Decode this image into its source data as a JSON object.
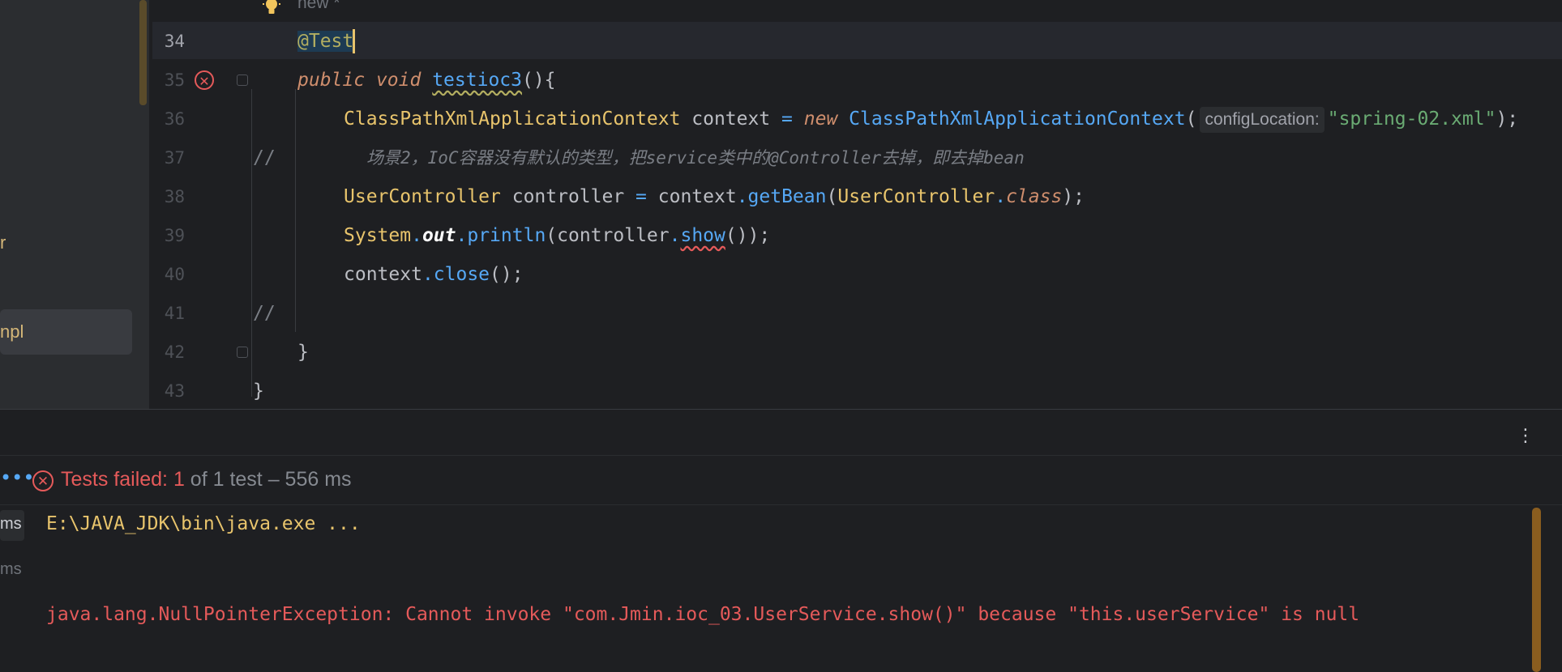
{
  "sidebar": {
    "items": [
      {
        "label": "r"
      },
      {
        "label": "npl"
      }
    ]
  },
  "editor": {
    "inlay_new": "new *",
    "lines": [
      {
        "num": "34"
      },
      {
        "num": "35"
      },
      {
        "num": "36"
      },
      {
        "num": "37"
      },
      {
        "num": "38"
      },
      {
        "num": "39"
      },
      {
        "num": "40"
      },
      {
        "num": "41"
      },
      {
        "num": "42"
      },
      {
        "num": "43"
      }
    ],
    "code": {
      "l34_annot": "@Test",
      "l35_kw1": "public",
      "l35_kw2": "void",
      "l35_name": "testioc3",
      "l35_rest": "(){",
      "l36_type": "ClassPathXmlApplicationContext",
      "l36_var": " context ",
      "l36_eq": "=",
      "l36_new": " new ",
      "l36_ctor": "ClassPathXmlApplicationContext",
      "l36_paren": "(",
      "l36_hint": "configLocation:",
      "l36_str": "\"spring-02.xml\"",
      "l36_end": ");",
      "l37_slash": "//",
      "l37_comment": "场景2，IoC容器没有默认的类型，把service类中的@Controller去掉，即去掉bean",
      "l38_type": "UserController",
      "l38_var": " controller ",
      "l38_eq": "=",
      "l38_ctx": " context",
      "l38_dot": ".",
      "l38_fn": "getBean",
      "l38_p1": "(",
      "l38_cls": "UserController",
      "l38_dot2": ".",
      "l38_kw": "class",
      "l38_end": ");",
      "l39_sys": "System",
      "l39_dot": ".",
      "l39_out": "out",
      "l39_dot2": ".",
      "l39_fn": "println",
      "l39_p1": "(controller",
      "l39_dot3": ".",
      "l39_show": "show",
      "l39_end": "());",
      "l40_ctx": "context",
      "l40_dot": ".",
      "l40_fn": "close",
      "l40_end": "();",
      "l41_slash": "//",
      "l42_brace": "}",
      "l43_brace": "}"
    }
  },
  "toolwindow": {
    "menu_icon": "kebab-menu-icon",
    "status_fail": "Tests failed: 1",
    "status_rest": " of 1 test – 556 ms",
    "left_times": [
      "ms",
      "ms"
    ],
    "console_cmd": "E:\\JAVA_JDK\\bin\\java.exe ...",
    "console_error": "java.lang.NullPointerException: Cannot invoke \"com.Jmin.ioc_03.UserService.show()\" because \"this.userService\" is null"
  },
  "colors": {
    "background": "#1e1f22",
    "error": "#e55a5a",
    "keyword": "#cf8e6d",
    "class": "#e8c46c",
    "function": "#56a8f5",
    "string": "#6aab73"
  }
}
